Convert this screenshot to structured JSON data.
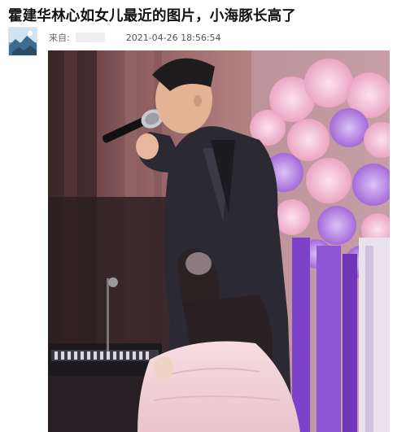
{
  "post": {
    "title": "霍建华林心如女儿最近的图片，小海豚长高了",
    "source_label": "来自:",
    "timestamp": "2021-04-26 18:56:54"
  },
  "icons": {
    "avatar": "landscape-avatar-icon",
    "microphone": "microphone-icon"
  },
  "colors": {
    "background": "#ffffff",
    "title_text": "#111111",
    "meta_text": "#666666",
    "curtain": "#a87778",
    "flowers_pink": "#f2b7cf",
    "flowers_purple": "#b57be0",
    "ribbon": "#7c42c9",
    "jacket": "#2b2a32",
    "dress": "#f3d4da"
  }
}
